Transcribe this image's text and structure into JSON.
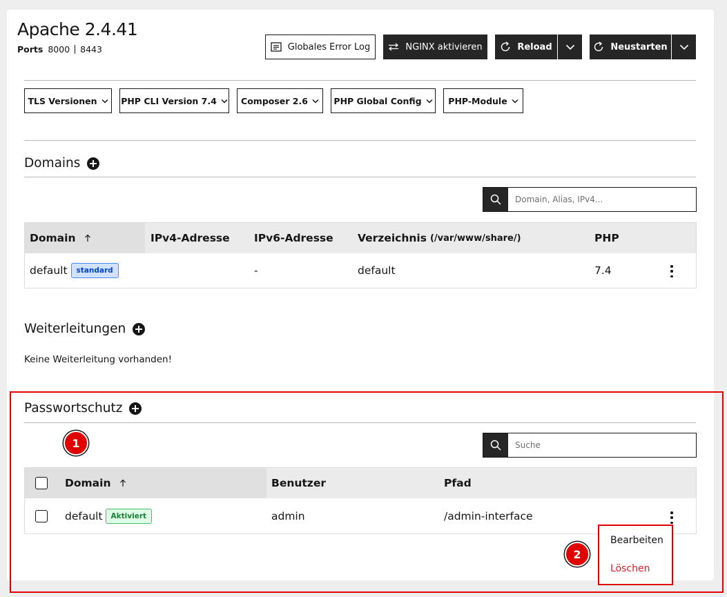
{
  "header": {
    "title": "Apache 2.4.41",
    "ports_label": "Ports",
    "port_http": "8000",
    "port_https": "8443"
  },
  "toolbar": {
    "error_log_label": "Globales Error Log",
    "nginx_label": "NGINX aktivieren",
    "reload_label": "Reload",
    "restart_label": "Neustarten"
  },
  "config_dropdowns": [
    {
      "label": "TLS Versionen"
    },
    {
      "label": "PHP CLI Version 7.4"
    },
    {
      "label": "Composer 2.6"
    },
    {
      "label": "PHP Global Config"
    },
    {
      "label": "PHP-Module"
    }
  ],
  "domains": {
    "title": "Domains",
    "search_placeholder": "Domain, Alias, IPv4...",
    "columns": {
      "domain": "Domain",
      "ipv4": "IPv4-Adresse",
      "ipv6": "IPv6-Adresse",
      "directory": "Verzeichnis",
      "directory_path": "(/var/www/share/)",
      "php": "PHP"
    },
    "rows": [
      {
        "domain": "default",
        "badge": "standard",
        "ipv4": "",
        "ipv6": "-",
        "directory": "default",
        "php": "7.4"
      }
    ]
  },
  "redirects": {
    "title": "Weiterleitungen",
    "empty_text": "Keine Weiterleitung vorhanden!"
  },
  "password_protection": {
    "title": "Passwortschutz",
    "search_placeholder": "Suche",
    "columns": {
      "domain": "Domain",
      "user": "Benutzer",
      "path": "Pfad"
    },
    "rows": [
      {
        "domain": "default",
        "badge": "Aktiviert",
        "user": "admin",
        "path": "/admin-interface"
      }
    ]
  },
  "context_menu": {
    "edit_label": "Bearbeiten",
    "delete_label": "Löschen"
  },
  "annotations": {
    "marker_1": "1",
    "marker_2": "2"
  },
  "colors": {
    "dark_button": "#262626",
    "highlight_red": "#e00000",
    "badge_standard": "#d0e2ff",
    "badge_active": "#defbe6",
    "delete_text": "#da1e28"
  }
}
